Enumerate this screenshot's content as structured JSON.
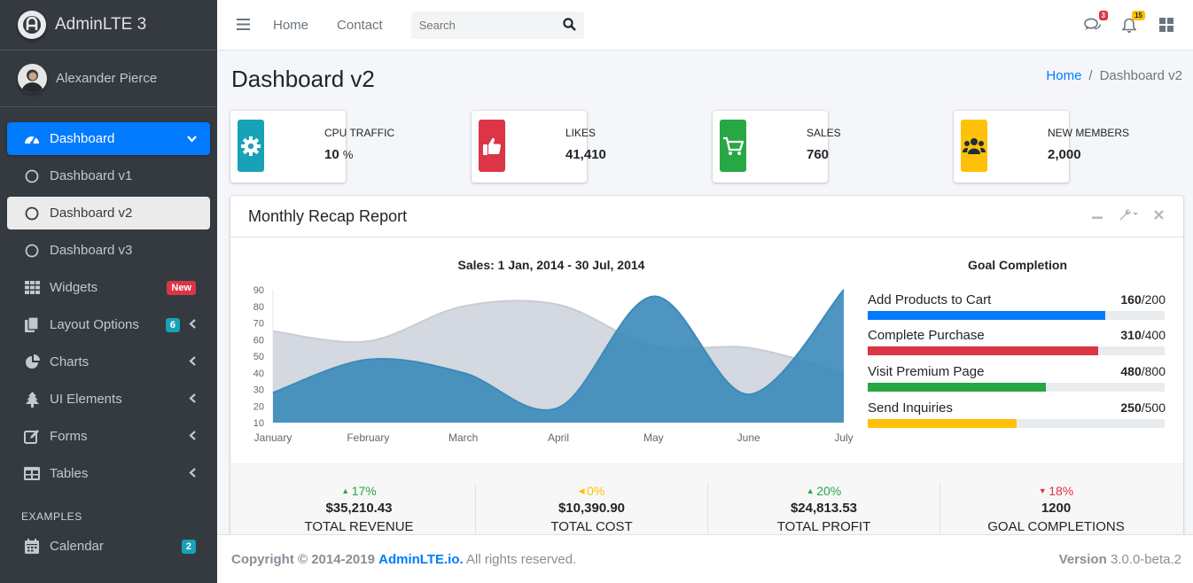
{
  "brand": {
    "name": "AdminLTE 3"
  },
  "user": {
    "name": "Alexander Pierce"
  },
  "sidebar": {
    "items": [
      {
        "label": "Dashboard",
        "icon": "tachometer-icon"
      },
      {
        "label": "Dashboard v1",
        "icon": "circle-icon"
      },
      {
        "label": "Dashboard v2",
        "icon": "circle-icon"
      },
      {
        "label": "Dashboard v3",
        "icon": "circle-icon"
      },
      {
        "label": "Widgets",
        "icon": "grid-icon",
        "badge": "New"
      },
      {
        "label": "Layout Options",
        "icon": "copy-icon",
        "badge": "6"
      },
      {
        "label": "Charts",
        "icon": "pie-chart-icon"
      },
      {
        "label": "UI Elements",
        "icon": "tree-icon"
      },
      {
        "label": "Forms",
        "icon": "edit-icon"
      },
      {
        "label": "Tables",
        "icon": "table-icon"
      }
    ],
    "header": "EXAMPLES",
    "calendar": {
      "label": "Calendar",
      "icon": "calendar-icon",
      "badge": "2"
    }
  },
  "topnav": {
    "links": [
      "Home",
      "Contact"
    ],
    "search_placeholder": "Search",
    "messages_count": "3",
    "notifications_count": "15"
  },
  "page": {
    "title": "Dashboard v2",
    "breadcrumb": [
      "Home",
      "Dashboard v2"
    ]
  },
  "info_boxes": [
    {
      "label": "CPU TRAFFIC",
      "value": "10",
      "unit": "%",
      "color": "#17a2b8",
      "icon": "gear-icon"
    },
    {
      "label": "LIKES",
      "value": "41,410",
      "unit": "",
      "color": "#dc3545",
      "icon": "thumbs-up-icon"
    },
    {
      "label": "SALES",
      "value": "760",
      "unit": "",
      "color": "#28a745",
      "icon": "shopping-cart-icon"
    },
    {
      "label": "NEW MEMBERS",
      "value": "2,000",
      "unit": "",
      "color": "#ffc107",
      "icon": "users-icon"
    }
  ],
  "report": {
    "title": "Monthly Recap Report",
    "chart_title": "Sales: 1 Jan, 2014 - 30 Jul, 2014",
    "goal_title": "Goal Completion",
    "goals": [
      {
        "label": "Add Products to Cart",
        "value": "160",
        "total": "/200",
        "fraction": 0.8,
        "color": "#007bff"
      },
      {
        "label": "Complete Purchase",
        "value": "310",
        "total": "/400",
        "fraction": 0.775,
        "color": "#dc3545"
      },
      {
        "label": "Visit Premium Page",
        "value": "480",
        "total": "/800",
        "fraction": 0.6,
        "color": "#28a745"
      },
      {
        "label": "Send Inquiries",
        "value": "250",
        "total": "/500",
        "fraction": 0.5,
        "color": "#ffc107"
      }
    ],
    "stats": [
      {
        "pct": "17%",
        "direction": "up",
        "color": "#28a745",
        "amount": "$35,210.43",
        "label": "Total Revenue"
      },
      {
        "pct": "0%",
        "direction": "left",
        "color": "#ffc107",
        "amount": "$10,390.90",
        "label": "Total Cost"
      },
      {
        "pct": "20%",
        "direction": "up",
        "color": "#28a745",
        "amount": "$24,813.53",
        "label": "Total Profit"
      },
      {
        "pct": "18%",
        "direction": "down",
        "color": "#dc3545",
        "amount": "1200",
        "label": "Goal Completions"
      }
    ]
  },
  "chart_data": {
    "type": "area",
    "title": "Sales: 1 Jan, 2014 - 30 Jul, 2014",
    "categories": [
      "January",
      "February",
      "March",
      "April",
      "May",
      "June",
      "July"
    ],
    "ylim": [
      10,
      90
    ],
    "yticks": [
      10,
      20,
      30,
      40,
      50,
      60,
      70,
      80,
      90
    ],
    "series": [
      {
        "values": [
          65,
          59,
          80,
          81,
          56,
          55,
          40
        ],
        "color": "#d2d6de"
      },
      {
        "values": [
          28,
          48,
          40,
          19,
          86,
          27,
          90
        ],
        "color": "#3b8bba"
      }
    ],
    "grid": false
  },
  "footer": {
    "copyright": "Copyright © 2014-2019",
    "link": "AdminLTE.io.",
    "rights": "All rights reserved.",
    "version_label": "Version",
    "version": "3.0.0-beta.2"
  }
}
